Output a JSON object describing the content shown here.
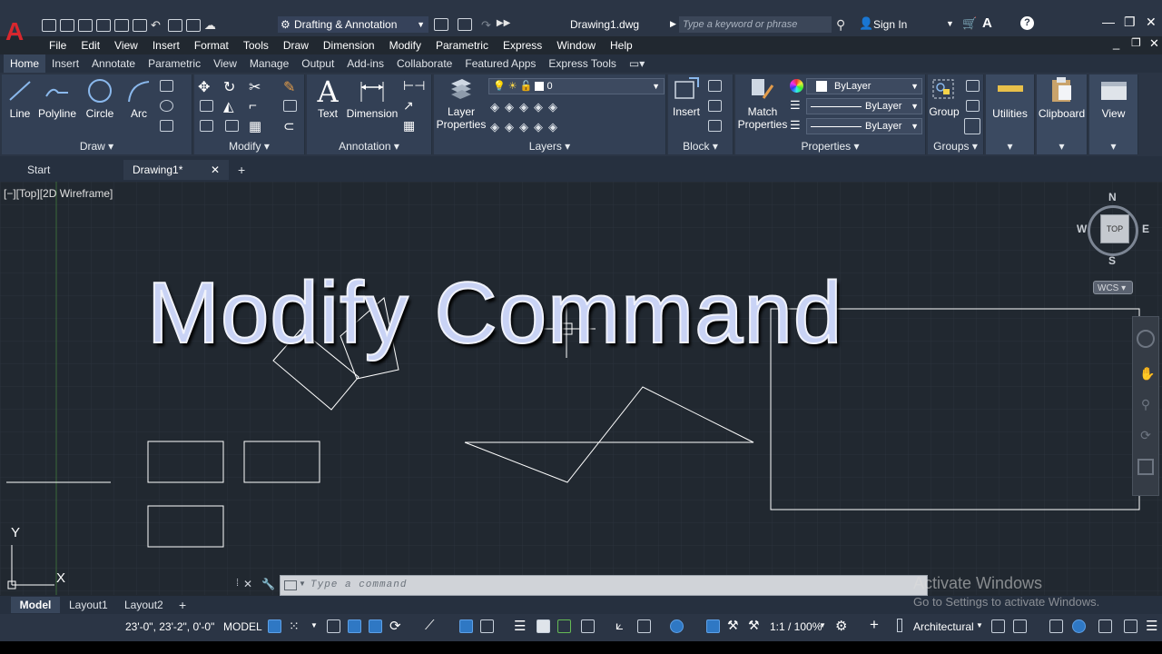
{
  "app": {
    "logo_letter": "A",
    "workspace": "Drafting & Annotation",
    "document_title": "Drawing1.dwg",
    "search_placeholder": "Type a keyword or phrase",
    "sign_in": "Sign In"
  },
  "menubar": [
    "File",
    "Edit",
    "View",
    "Insert",
    "Format",
    "Tools",
    "Draw",
    "Dimension",
    "Modify",
    "Parametric",
    "Express",
    "Window",
    "Help"
  ],
  "ribbon_tabs": [
    "Home",
    "Insert",
    "Annotate",
    "Parametric",
    "View",
    "Manage",
    "Output",
    "Add-ins",
    "Collaborate",
    "Featured Apps",
    "Express Tools"
  ],
  "ribbon": {
    "draw": {
      "title": "Draw",
      "buttons": [
        "Line",
        "Polyline",
        "Circle",
        "Arc"
      ]
    },
    "modify": {
      "title": "Modify"
    },
    "annotation": {
      "title": "Annotation",
      "buttons": [
        "Text",
        "Dimension"
      ]
    },
    "layers": {
      "title": "Layers",
      "button_line1": "Layer",
      "button_line2": "Properties",
      "current_layer": "0"
    },
    "block": {
      "title": "Block",
      "button": "Insert"
    },
    "properties": {
      "title": "Properties",
      "match_line1": "Match",
      "match_line2": "Properties",
      "color": "ByLayer",
      "linetype": "ByLayer",
      "lineweight": "ByLayer"
    },
    "groups": {
      "title": "Groups",
      "button": "Group"
    },
    "utilities": {
      "title": "Utilities"
    },
    "clipboard": {
      "title": "Clipboard"
    },
    "view": {
      "title": "View"
    }
  },
  "file_tabs": {
    "start": "Start",
    "drawing": "Drawing1*"
  },
  "viewport_label": "[−][Top][2D Wireframe]",
  "viewcube": {
    "n": "N",
    "s": "S",
    "e": "E",
    "w": "W",
    "face": "TOP",
    "wcs": "WCS"
  },
  "canvas_title": "Modify Command",
  "ucs": {
    "y": "Y",
    "x": "X"
  },
  "command_placeholder": "Type a command",
  "layout_tabs": [
    "Model",
    "Layout1",
    "Layout2"
  ],
  "status": {
    "coords": "23'-0\", 23'-2\", 0'-0\"",
    "model": "MODEL",
    "scale": "1:1 / 100%",
    "units": "Architectural"
  },
  "watermark": {
    "line1": "Activate Windows",
    "line2": "Go to Settings to activate Windows."
  },
  "colors": {
    "accent": "#2f78c4",
    "logo": "#d8272e",
    "canvas": "#212830",
    "ribbon": "#334055"
  }
}
